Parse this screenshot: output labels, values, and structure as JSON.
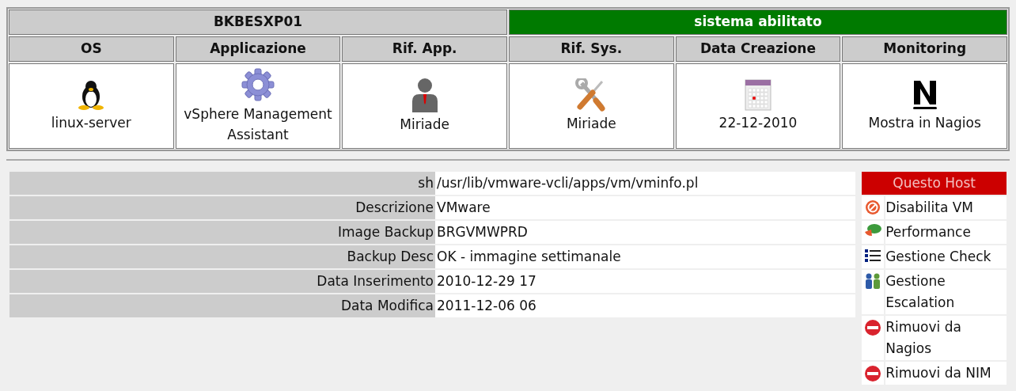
{
  "host": {
    "name": "BKBESXP01",
    "status": "sistema abilitato"
  },
  "summary": [
    {
      "header": "OS",
      "value": "linux-server"
    },
    {
      "header": "Applicazione",
      "value": "vSphere Management Assistant"
    },
    {
      "header": "Rif. App.",
      "value": "Miriade"
    },
    {
      "header": "Rif. Sys.",
      "value": "Miriade"
    },
    {
      "header": "Data Creazione",
      "value": "22-12-2010"
    },
    {
      "header": "Monitoring",
      "value": "Mostra in Nagios"
    }
  ],
  "details": [
    {
      "label": "sh",
      "value": "/usr/lib/vmware-vcli/apps/vm/vminfo.pl"
    },
    {
      "label": "Descrizione",
      "value": "VMware"
    },
    {
      "label": "Image Backup",
      "value": "BRGVMWPRD"
    },
    {
      "label": "Backup Desc",
      "value": "OK - immagine settimanale"
    },
    {
      "label": "Data Inserimento",
      "value": "2010-12-29 17"
    },
    {
      "label": "Data Modifica",
      "value": "2011-12-06 06"
    }
  ],
  "actions": {
    "title": "Questo Host",
    "items": [
      {
        "label": "Disabilita VM"
      },
      {
        "label": "Performance"
      },
      {
        "label": "Gestione Check"
      },
      {
        "label": "Gestione Escalation"
      },
      {
        "label": "Rimuovi da Nagios"
      },
      {
        "label": "Rimuovi da NIM"
      }
    ]
  }
}
